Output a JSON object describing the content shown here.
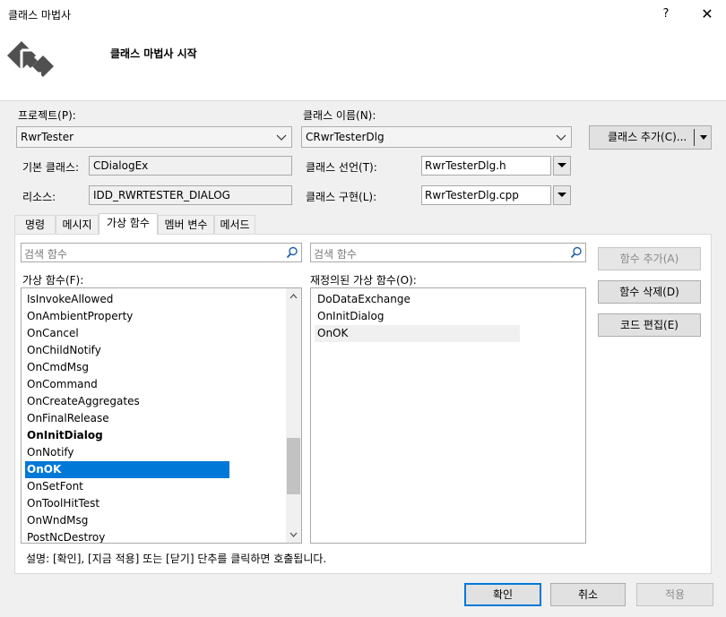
{
  "window": {
    "title": "클래스 마법사",
    "help": "?",
    "close": "✕"
  },
  "header": {
    "title": "클래스 마법사 시작"
  },
  "project": {
    "label": "프로젝트(P):",
    "value": "RwrTester"
  },
  "class_name": {
    "label": "클래스 이름(N):",
    "value": "CRwrTesterDlg"
  },
  "add_class_button": "클래스 추가(C)...",
  "base_class": {
    "label": "기본 클래스:",
    "value": "CDialogEx"
  },
  "resource": {
    "label": "리소스:",
    "value": "IDD_RWRTESTER_DIALOG"
  },
  "class_decl": {
    "label": "클래스 선언(T):",
    "value": "RwrTesterDlg.h"
  },
  "class_impl": {
    "label": "클래스 구현(L):",
    "value": "RwrTesterDlg.cpp"
  },
  "tabs": [
    "명령",
    "메시지",
    "가상 함수",
    "멤버 변수",
    "메서드"
  ],
  "search_left": {
    "placeholder": "검색 함수"
  },
  "search_right": {
    "placeholder": "검색 함수"
  },
  "virtual_functions": {
    "label": "가상 함수(F):",
    "items": [
      "IsInvokeAllowed",
      "OnAmbientProperty",
      "OnCancel",
      "OnChildNotify",
      "OnCmdMsg",
      "OnCommand",
      "OnCreateAggregates",
      "OnFinalRelease",
      "OnInitDialog",
      "OnNotify",
      "OnOK",
      "OnSetFont",
      "OnToolHitTest",
      "OnWndMsg",
      "PostNcDestroy"
    ]
  },
  "overridden_functions": {
    "label": "재정의된 가상 함수(O):",
    "items": [
      "DoDataExchange",
      "OnInitDialog",
      "OnOK"
    ]
  },
  "buttons": {
    "add_function": "함수 추가(A)",
    "delete_function": "함수 삭제(D)",
    "edit_code": "코드 편집(E)",
    "ok": "확인",
    "cancel": "취소",
    "apply": "적용"
  },
  "description": "설명:   [확인], [지금 적용] 또는 [닫기] 단추를 클릭하면 호출됩니다.",
  "colors": {
    "accent": "#0078d7",
    "logo": "#505050"
  }
}
